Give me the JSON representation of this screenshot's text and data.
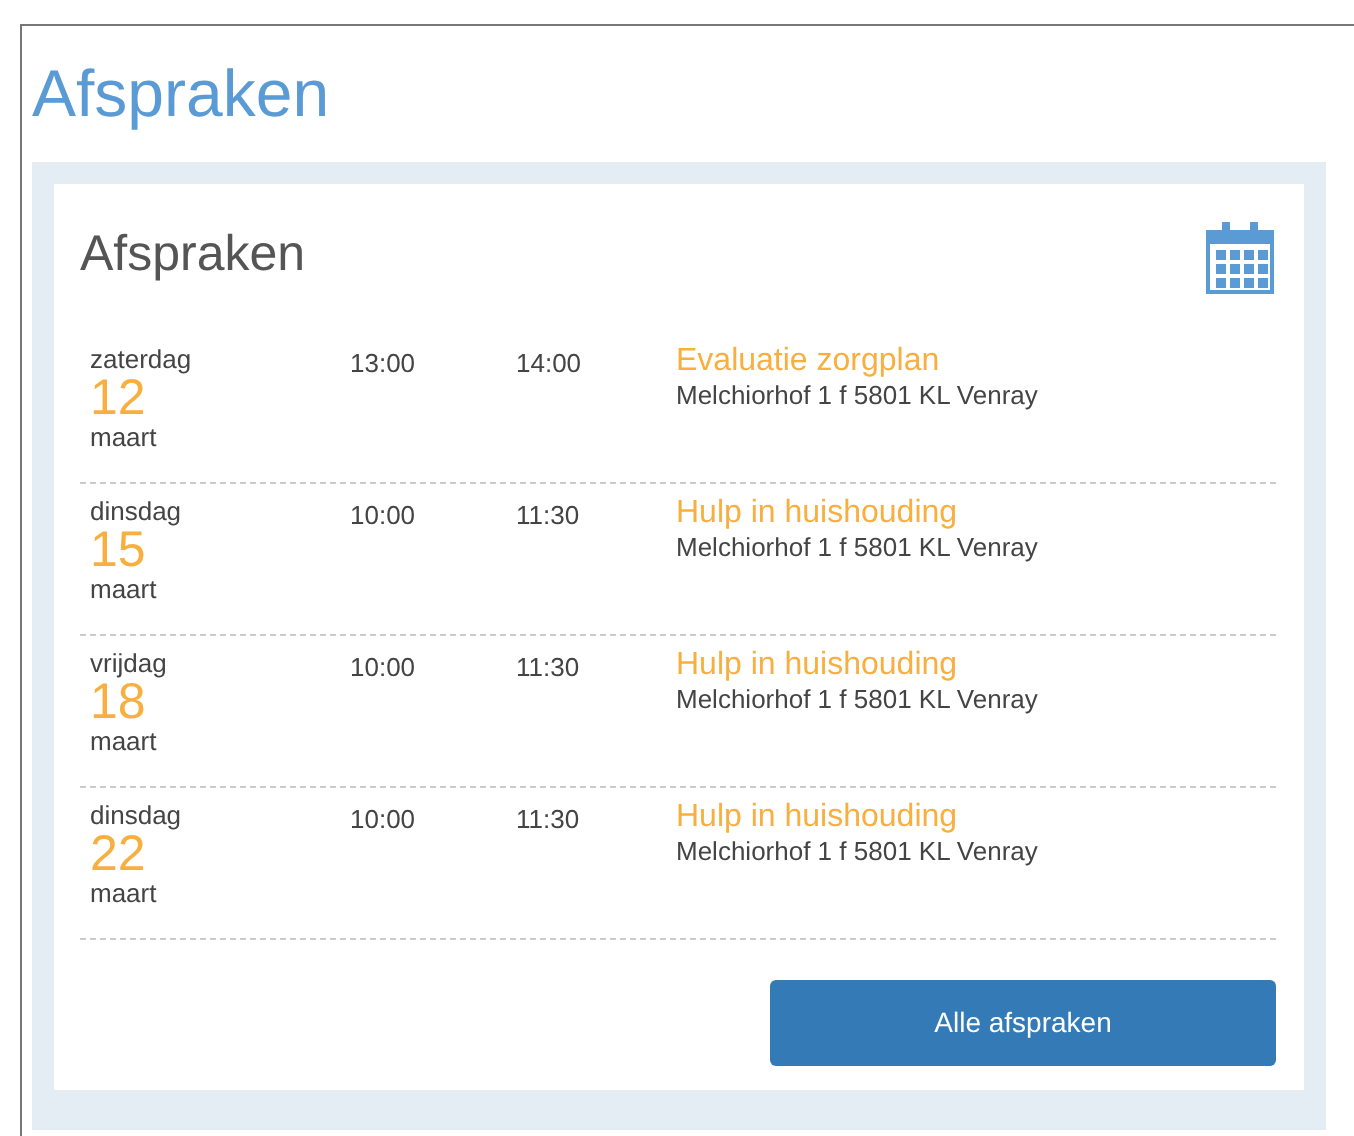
{
  "page_title": "Afspraken",
  "card": {
    "title": "Afspraken",
    "appointments": [
      {
        "weekday": "zaterdag",
        "day": "12",
        "month": "maart",
        "start": "13:00",
        "end": "14:00",
        "title": "Evaluatie zorgplan",
        "address": "Melchiorhof 1 f 5801 KL Venray"
      },
      {
        "weekday": "dinsdag",
        "day": "15",
        "month": "maart",
        "start": "10:00",
        "end": "11:30",
        "title": "Hulp in huishouding",
        "address": "Melchiorhof 1 f 5801 KL Venray"
      },
      {
        "weekday": "vrijdag",
        "day": "18",
        "month": "maart",
        "start": "10:00",
        "end": "11:30",
        "title": "Hulp in huishouding",
        "address": "Melchiorhof 1 f 5801 KL Venray"
      },
      {
        "weekday": "dinsdag",
        "day": "22",
        "month": "maart",
        "start": "10:00",
        "end": "11:30",
        "title": "Hulp in huishouding",
        "address": "Melchiorhof 1 f 5801 KL Venray"
      }
    ],
    "button": "Alle afspraken"
  }
}
